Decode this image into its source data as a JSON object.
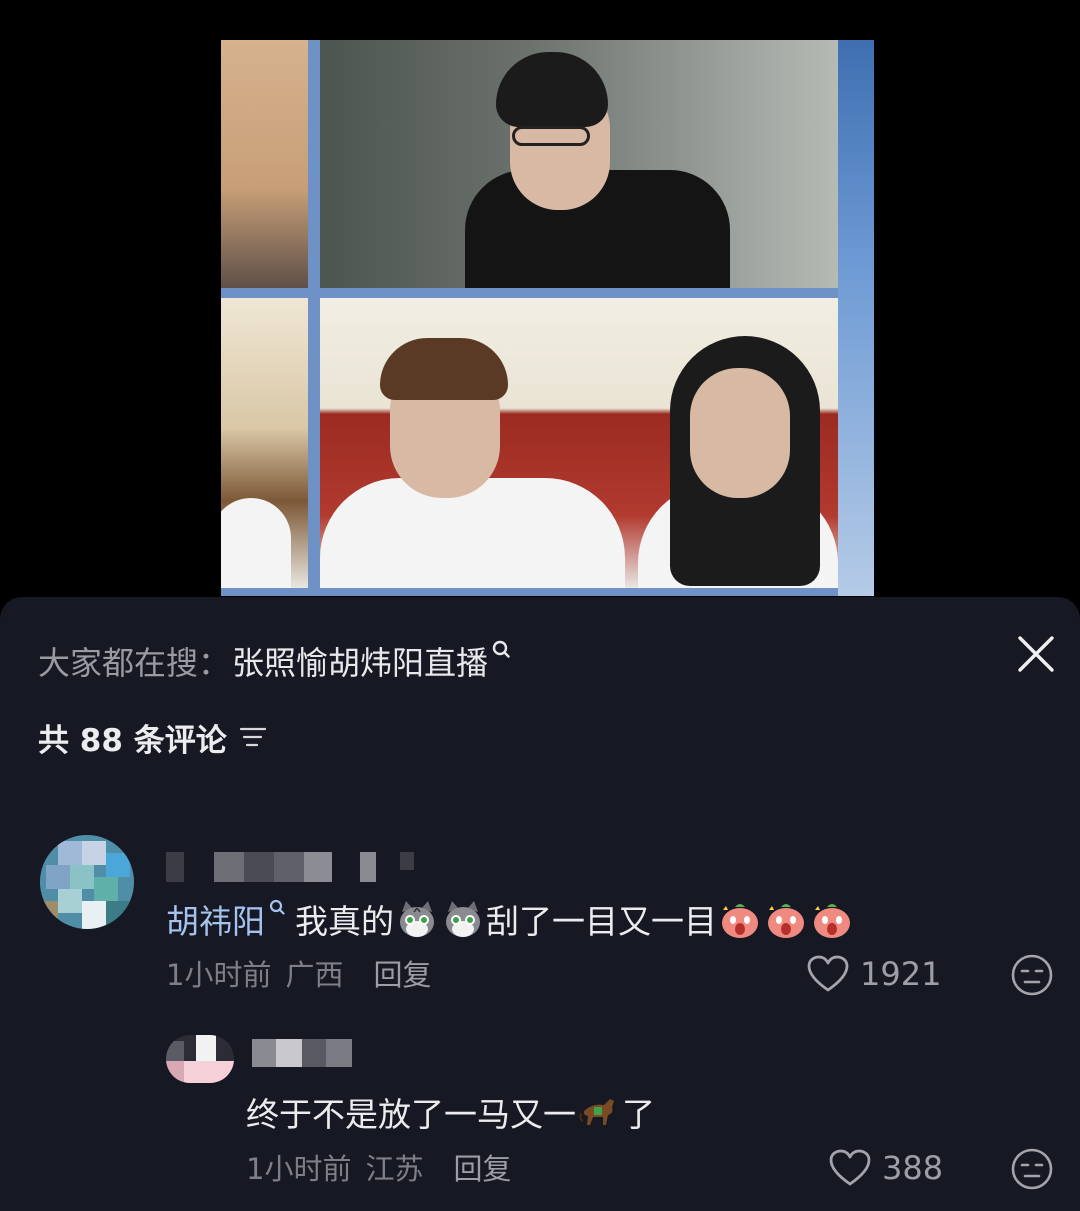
{
  "search": {
    "prefix": "大家都在搜：",
    "term": "张照愉胡炜阳直播"
  },
  "comments_header": {
    "count_text": "共 88 条评论"
  },
  "comments": [
    {
      "mention": "胡祎阳",
      "text_before_emoji": "我真的",
      "text_after_emoji": "刮了一目又一目",
      "time": "1小时前",
      "location": "广西",
      "reply_label": "回复",
      "likes": "1921"
    }
  ],
  "replies": [
    {
      "text_before_emoji": "终于不是放了一马又一",
      "text_after_emoji": "了",
      "time": "1小时前",
      "location": "江苏",
      "reply_label": "回复",
      "likes": "388"
    }
  ],
  "icons": {
    "close": "close-icon",
    "sort": "sort-icon",
    "heart": "heart-icon",
    "dislike": "dislike-face-icon",
    "search_mini": "search-icon",
    "cat_emoji": "cat-emoji-icon",
    "peach_emoji": "peach-emoji-icon",
    "horse_emoji": "horse-emoji-icon"
  },
  "colors": {
    "panel_bg": "#161823",
    "mention": "#a6c3ee",
    "meta": "#7d7e86"
  }
}
